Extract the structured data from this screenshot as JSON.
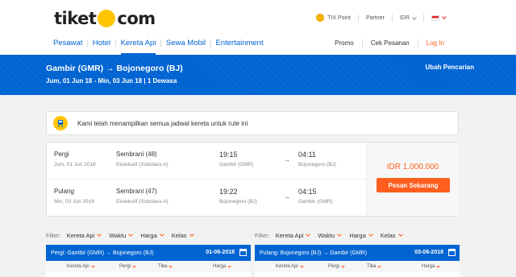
{
  "header": {
    "logo_left": "tiket",
    "logo_right": "com",
    "tix_point": "TIX Point",
    "partner": "Partner",
    "currency": "IDR"
  },
  "nav": {
    "items": [
      "Pesawat",
      "Hotel",
      "Kereta Api",
      "Sewa Mobil",
      "Entertainment"
    ],
    "right": {
      "promo": "Promo",
      "cek_pesanan": "Cek Pesanan",
      "login": "Log In"
    }
  },
  "banner": {
    "origin": "Gambir (GMR)",
    "destination": "Bojonegoro (BJ)",
    "details": "Jum, 01 Jun 18 - Min, 03 Jun 18 | 1 Dewasa",
    "change_search": "Ubah Pencarian"
  },
  "notice": {
    "text": "Kami telah menampilkan semua jadwal kereta untuk rute ini"
  },
  "trip": {
    "legs": [
      {
        "title": "Pergi",
        "date": "Jum, 01 Jun 2018",
        "train": "Sembrani (48)",
        "class": "Eksekutif (Subclass A)",
        "depart_time": "19:15",
        "depart_station": "Gambir (GMR)",
        "arrive_time": "04:11",
        "arrive_station": "Bojonegoro (BJ)"
      },
      {
        "title": "Pulang",
        "date": "Min, 03 Jun 2018",
        "train": "Sembrani (47)",
        "class": "Eksekutif (Subclass A)",
        "depart_time": "19:22",
        "depart_station": "Bojonegoro (BJ)",
        "arrive_time": "04:15",
        "arrive_station": "Gambir (GMR)"
      }
    ],
    "price": "IDR 1.000.000",
    "book_label": "Pesan Sekarang"
  },
  "filters": {
    "label": "Filter:",
    "items": [
      "Kereta Api",
      "Waktu",
      "Harga",
      "Kelas"
    ]
  },
  "panels": [
    {
      "title": "Pergi: Gambir (GMR) → Bojonegoro (BJ)",
      "date": "01-06-2018"
    },
    {
      "title": "Pulang: Bojonegoro (BJ) → Gambir (GMR)",
      "date": "03-06-2018"
    }
  ],
  "columns": [
    "Kereta Api",
    "Pergi",
    "Tiba",
    "Harga"
  ],
  "colors": {
    "brand_blue": "#0064d2",
    "accent_orange": "#ff5e1f",
    "logo_yellow": "#ffc400"
  }
}
